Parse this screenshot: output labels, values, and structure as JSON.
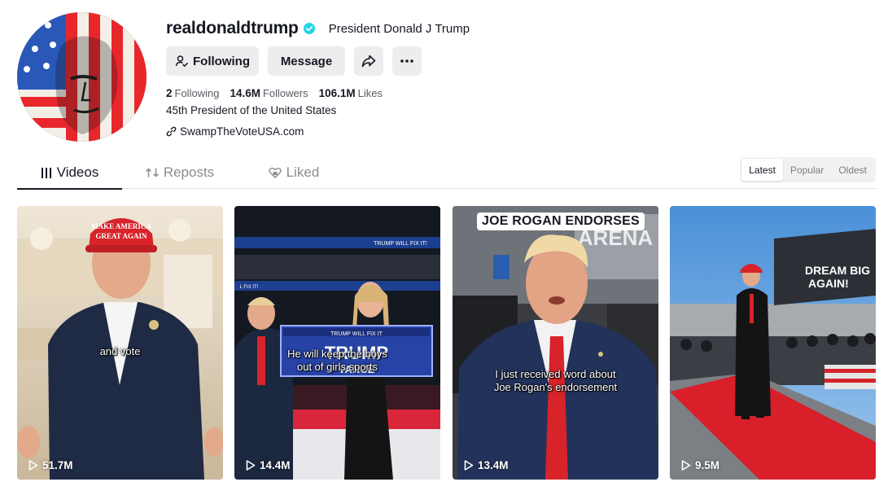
{
  "profile": {
    "username": "realdonaldtrump",
    "nickname": "President Donald J Trump",
    "bio": "45th President of the United States",
    "link": "SwampTheVoteUSA.com",
    "verified_color": "#20d5ec"
  },
  "buttons": {
    "following": "Following",
    "message": "Message"
  },
  "stats": {
    "following_count": "2",
    "following_label": "Following",
    "followers_count": "14.6M",
    "followers_label": "Followers",
    "likes_count": "106.1M",
    "likes_label": "Likes"
  },
  "tabs": [
    {
      "label": "Videos",
      "icon": "grid-icon",
      "active": true
    },
    {
      "label": "Reposts",
      "icon": "repost-icon",
      "active": false
    },
    {
      "label": "Liked",
      "icon": "liked-heart-icon",
      "active": false
    }
  ],
  "sort": {
    "options": [
      "Latest",
      "Popular",
      "Oldest"
    ],
    "selected": "Latest"
  },
  "videos": [
    {
      "caption": "and vote",
      "views": "51.7M"
    },
    {
      "caption_line1": "He will keep the boys",
      "caption_line2": "out of girls sports",
      "views": "14.4M"
    },
    {
      "banner": "JOE ROGAN ENDORSES",
      "caption_line1": "I just received word about",
      "caption_line2": "Joe Rogan's endorsement",
      "views": "13.4M"
    },
    {
      "views": "9.5M"
    }
  ]
}
